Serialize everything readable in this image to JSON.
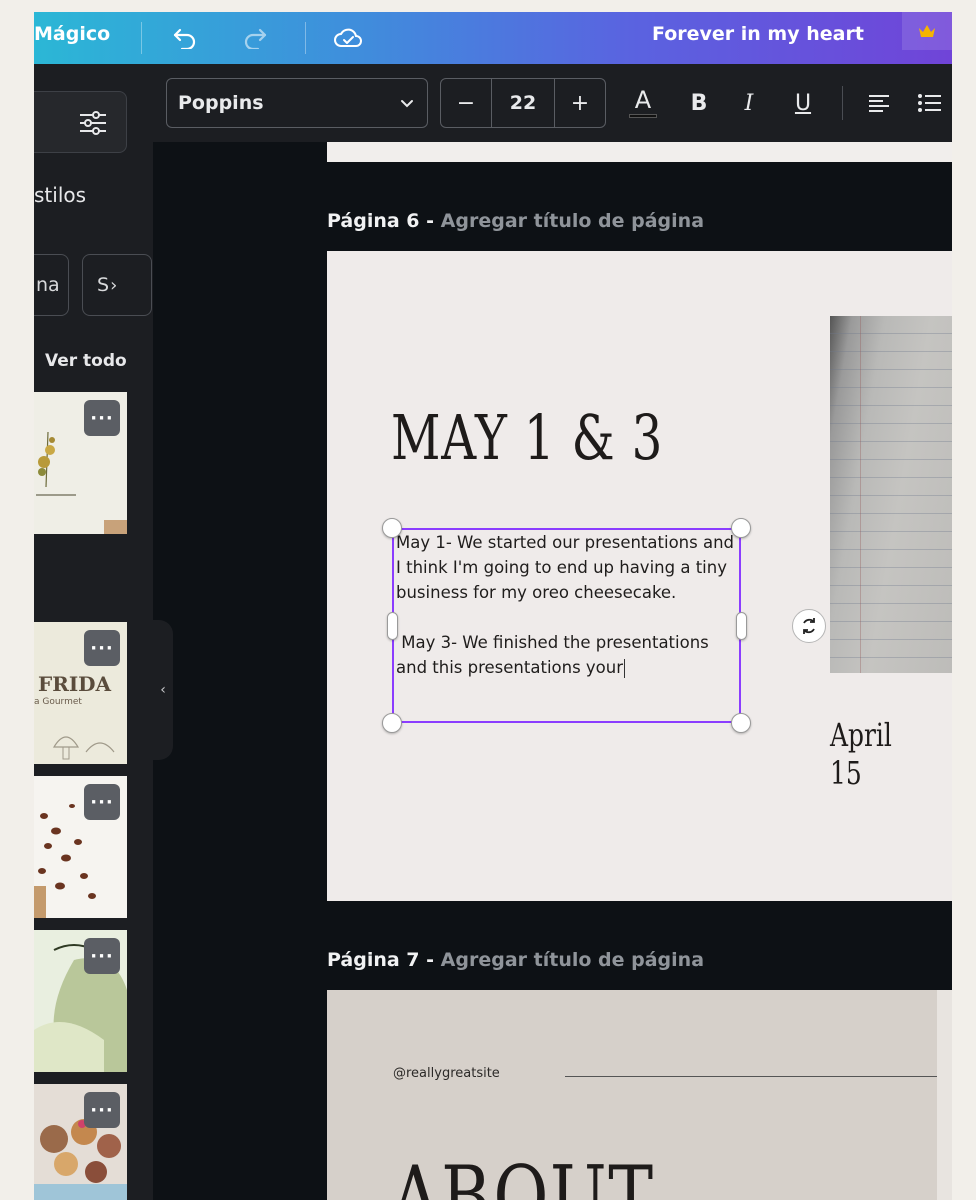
{
  "topbar": {
    "brand": "Mágico",
    "doc_title": "Forever in my heart"
  },
  "sidebar": {
    "title": "stilos",
    "chips": [
      "na",
      "S"
    ],
    "ver_todo": "Ver todo",
    "templates": [
      {
        "text": ""
      },
      {
        "text": "FRIDA",
        "subtext": "a Gourmet"
      },
      {
        "text": ""
      },
      {
        "text": ""
      },
      {
        "text": ""
      }
    ],
    "more_label": "···"
  },
  "toolbar": {
    "font": "Poppins",
    "font_size": "22",
    "minus": "−",
    "plus": "+",
    "color_letter": "A",
    "bold": "B",
    "italic": "I",
    "underline": "U"
  },
  "pages": [
    {
      "label": "Página 6 -",
      "title_placeholder": "Agregar título de página",
      "heading": "MAY 1 & 3",
      "body_p1": "May 1- We started our presentations and I think I'm going to end up having a tiny business for my oreo cheesecake.",
      "body_p2": " May 3- We finished the presentations and this presentations your",
      "caption": "April 15"
    },
    {
      "label": "Página 7 -",
      "title_placeholder": "Agregar título de página",
      "handle": "@reallygreatsite",
      "heading": "ABOUT"
    }
  ],
  "colors": {
    "selection": "#8b3dff",
    "canvas_bg": "#0d1115",
    "panel_bg": "#1c1e22"
  }
}
